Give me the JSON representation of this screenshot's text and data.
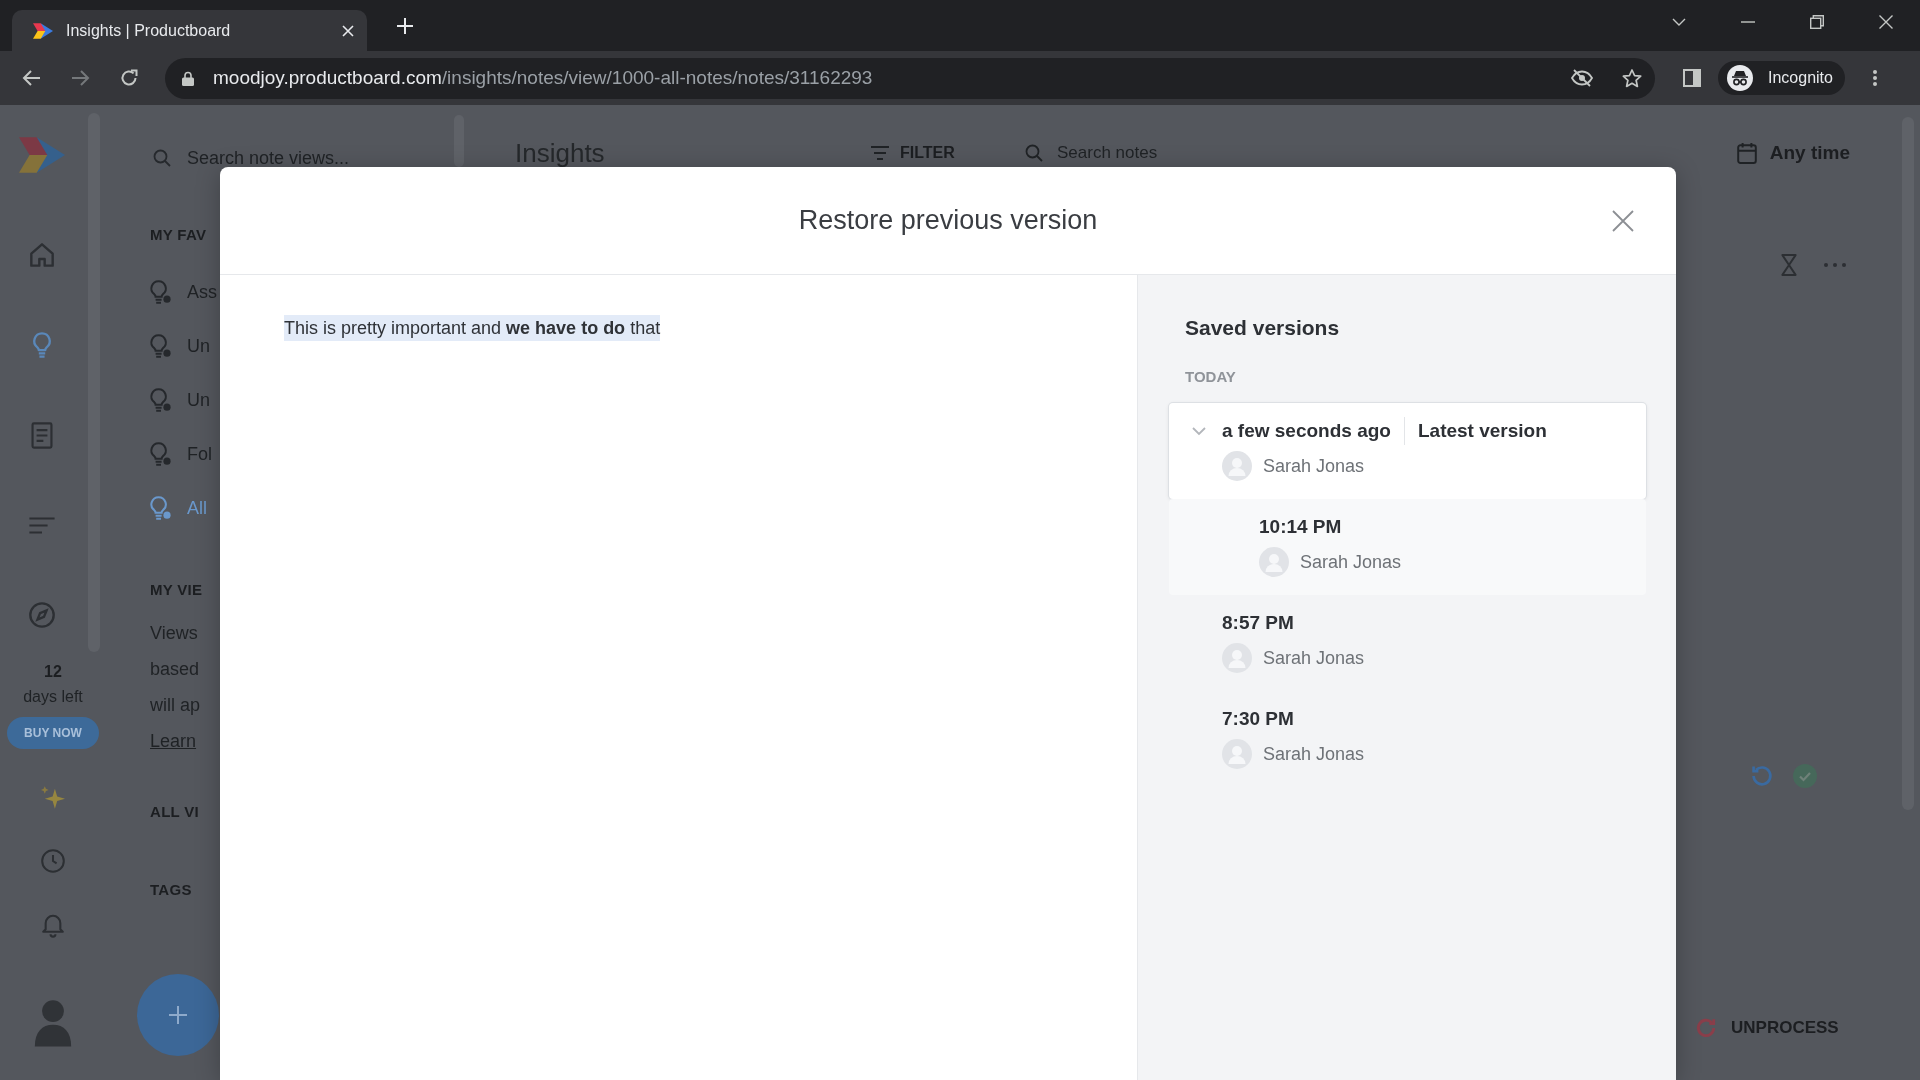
{
  "browser": {
    "tab": {
      "title": "Insights | Productboard"
    },
    "address_bar": {
      "host": "moodjoy.productboard.com",
      "path": "/insights/notes/view/1000-all-notes/notes/31162293"
    },
    "profile": {
      "label": "Incognito"
    }
  },
  "nav": {
    "items": [
      {
        "kind": "home",
        "selected": false
      },
      {
        "kind": "insights",
        "selected": true
      },
      {
        "kind": "notes",
        "selected": false
      },
      {
        "kind": "roadmap",
        "selected": false
      },
      {
        "kind": "explore",
        "selected": false
      }
    ],
    "trial": {
      "days": "12",
      "caption": "days left",
      "button": "BUY NOW"
    }
  },
  "views_panel": {
    "search": {
      "placeholder": "Search note views..."
    },
    "favorites": {
      "heading": "MY FAV",
      "items": [
        {
          "label": "Ass",
          "selected": false
        },
        {
          "label": "Un",
          "selected": false
        },
        {
          "label": "Un",
          "selected": false
        },
        {
          "label": "Fol",
          "selected": false
        },
        {
          "label": "All",
          "selected": true
        }
      ]
    },
    "my_views": {
      "heading": "MY VIE",
      "description": [
        "Views",
        "based",
        "will ap"
      ],
      "link": "Learn"
    },
    "all_views": {
      "heading": "ALL VI"
    },
    "tags": {
      "heading": "TAGS"
    }
  },
  "main": {
    "title": "Insights",
    "filter": {
      "label": "FILTER"
    },
    "search": {
      "placeholder": "Search notes"
    },
    "date_filter": {
      "label": "Any time"
    },
    "unprocess": {
      "label": "UNPROCESS"
    }
  },
  "modal": {
    "title": "Restore previous version",
    "content": {
      "text": "This is pretty important and **we have to do** that",
      "highlighted": true
    },
    "saved_versions": {
      "title": "Saved versions",
      "groups": [
        {
          "label": "TODAY",
          "versions": [
            {
              "time": "a few seconds ago",
              "badge": "Latest version",
              "author": "Sarah Jonas",
              "selected": true,
              "expanded": true,
              "children": [
                {
                  "time": "10:14 PM",
                  "author": "Sarah Jonas",
                  "selected": false
                }
              ]
            },
            {
              "time": "8:57 PM",
              "author": "Sarah Jonas",
              "selected": false
            },
            {
              "time": "7:30 PM",
              "author": "Sarah Jonas",
              "selected": false
            }
          ]
        }
      ]
    }
  }
}
